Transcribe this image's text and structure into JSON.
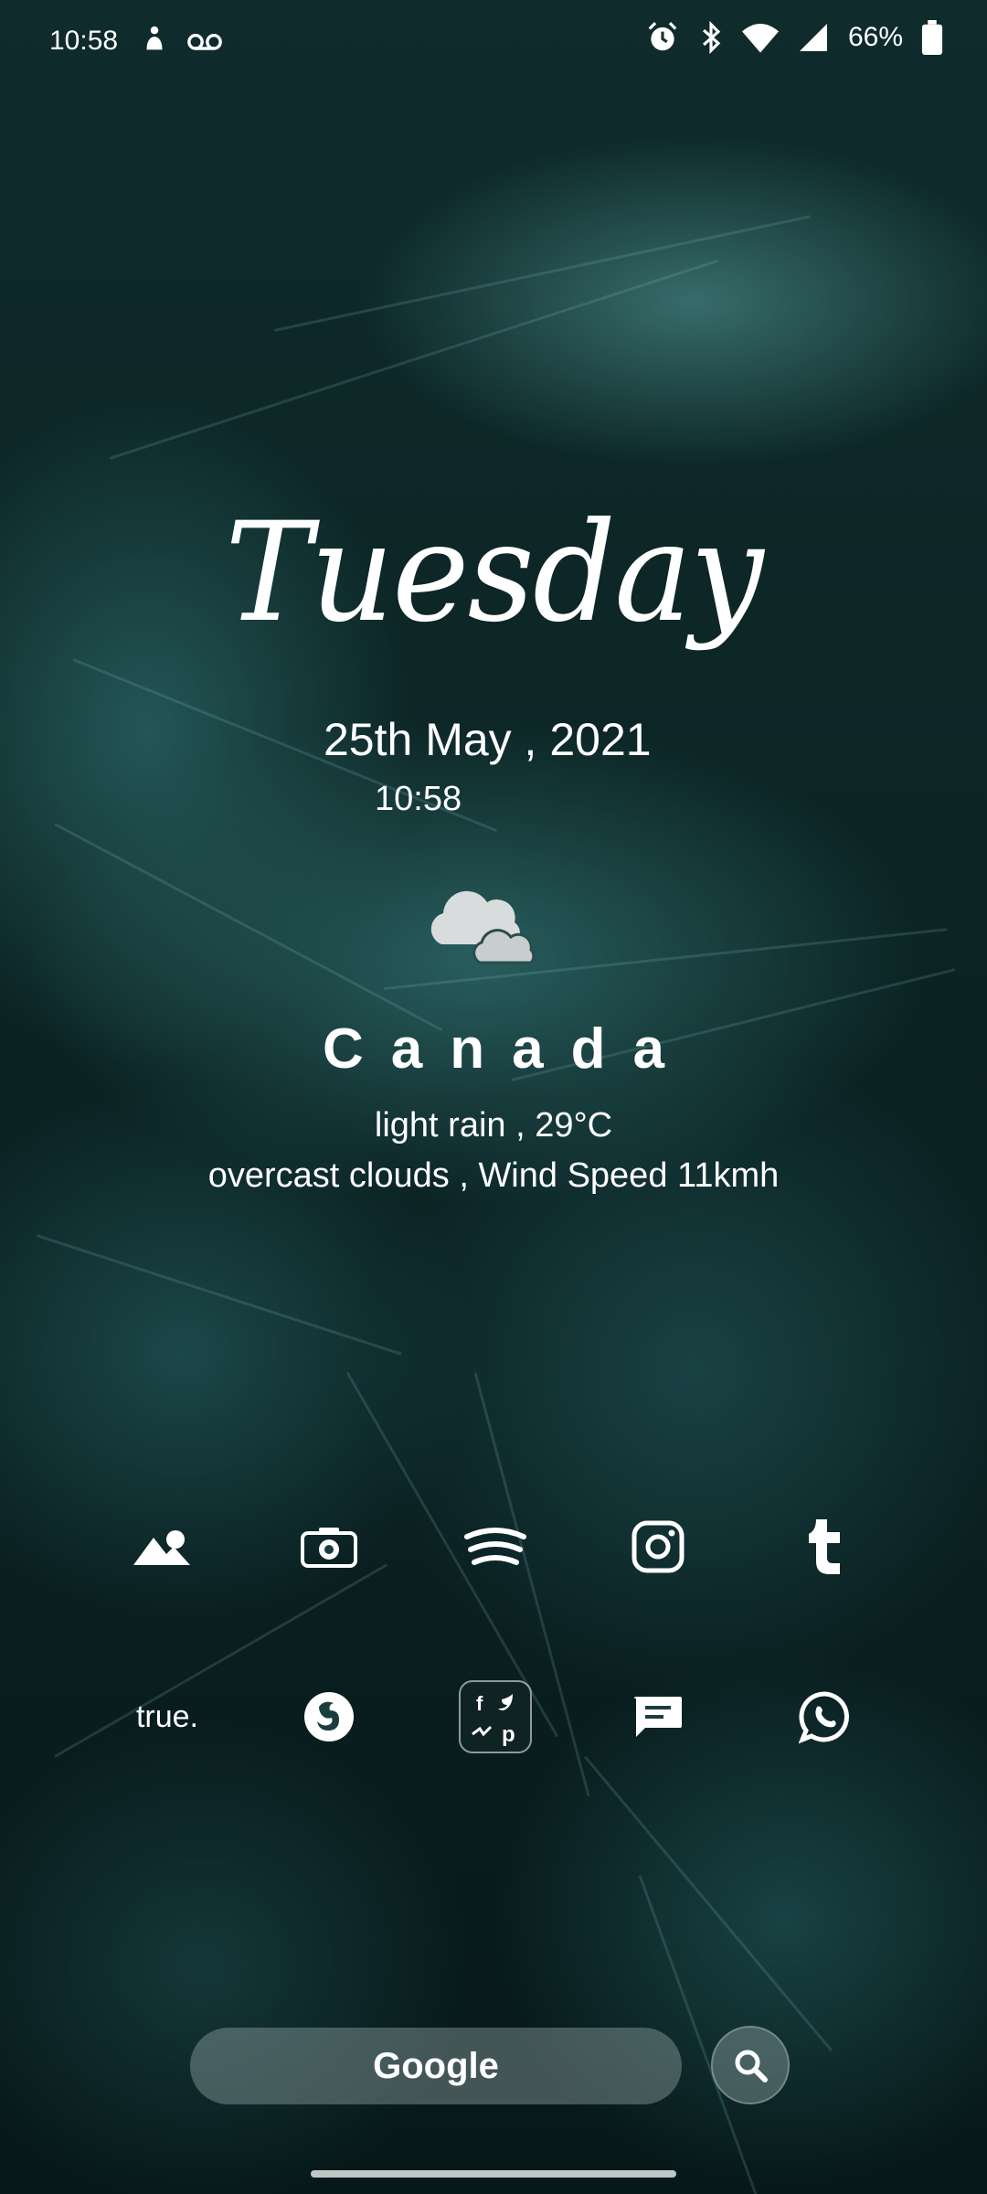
{
  "status_bar": {
    "time": "10:58",
    "battery_percent": "66%",
    "left_icons": [
      "notification-person-icon",
      "voicemail-icon"
    ],
    "right_icons": [
      "alarm-icon",
      "bluetooth-icon",
      "wifi-icon",
      "signal-icon",
      "battery-icon"
    ],
    "battery_level": 0.66
  },
  "widget": {
    "day": "Tuesday",
    "date": "25th May , 2021",
    "time": "10:58",
    "weather_icon": "cloudy-icon",
    "city": "Canada",
    "condition_line1": "light rain , 29°C",
    "condition_line2": "overcast clouds , Wind Speed 11kmh"
  },
  "dock_row1": [
    {
      "name": "gallery-icon"
    },
    {
      "name": "camera-icon"
    },
    {
      "name": "spotify-icon"
    },
    {
      "name": "instagram-icon"
    },
    {
      "name": "tumblr-icon"
    }
  ],
  "dock_row2": [
    {
      "name": "true-app",
      "label": "true."
    },
    {
      "name": "firefox-icon"
    },
    {
      "name": "social-folder-icon"
    },
    {
      "name": "messages-icon"
    },
    {
      "name": "whatsapp-icon"
    }
  ],
  "search": {
    "label": "Google",
    "icon": "search-icon"
  },
  "colors": {
    "wallpaper": "#0f2b2c",
    "text": "#ffffff"
  }
}
